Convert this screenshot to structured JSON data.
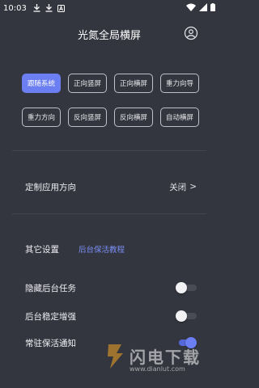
{
  "status_bar": {
    "time": "10:03"
  },
  "header": {
    "title": "光氮全局横屏"
  },
  "modes": [
    {
      "label": "跟随系统",
      "active": true
    },
    {
      "label": "正向竖屏",
      "active": false
    },
    {
      "label": "正向横屏",
      "active": false
    },
    {
      "label": "重力向导",
      "active": false
    },
    {
      "label": "重力方向",
      "active": false
    },
    {
      "label": "反向竖屏",
      "active": false
    },
    {
      "label": "反向横屏",
      "active": false
    },
    {
      "label": "自动横屏",
      "active": false
    }
  ],
  "custom_direction": {
    "label": "定制应用方向",
    "value": "关闭",
    "chevron": ">"
  },
  "other_settings": {
    "label": "其它设置",
    "link": "后台保活教程"
  },
  "settings": [
    {
      "label": "隐藏后台任务",
      "on": false
    },
    {
      "label": "后台稳定增强",
      "on": false
    },
    {
      "label": "常驻保活通知",
      "on": true
    }
  ],
  "watermark": {
    "text": "闪电下载",
    "url": "www.dianlut.com"
  },
  "colors": {
    "background": "#34363f",
    "accent": "#6b7ef2",
    "button_border": "#bfc1c8"
  }
}
